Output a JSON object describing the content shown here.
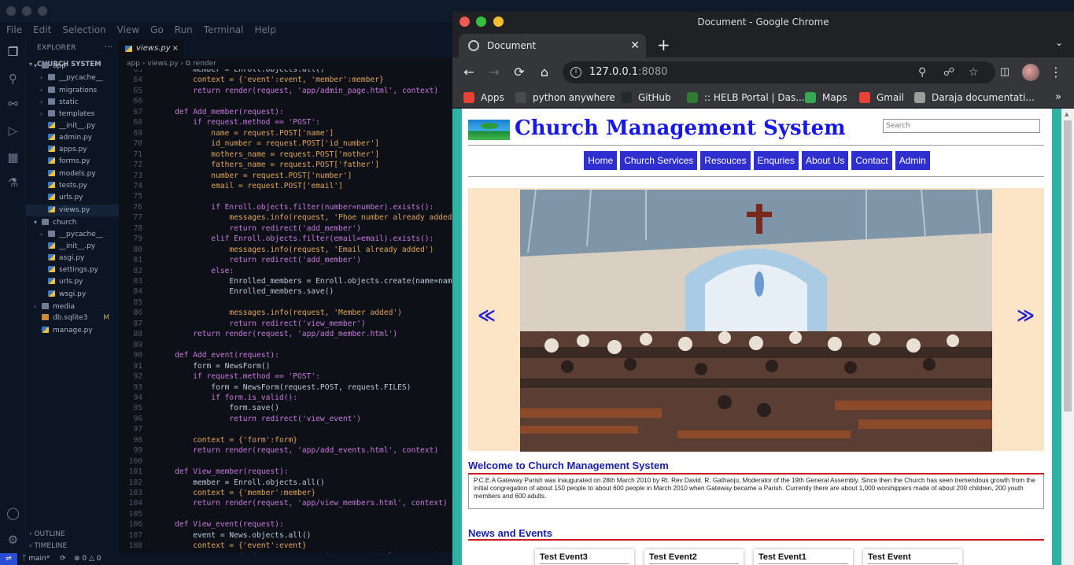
{
  "vscode": {
    "menu": [
      "File",
      "Edit",
      "Selection",
      "View",
      "Go",
      "Run",
      "Terminal",
      "Help"
    ],
    "explorer_label": "EXPLORER",
    "project_label": "CHURCH SYSTEM",
    "tree": [
      {
        "label": "app",
        "type": "folder",
        "open": true,
        "indent": 0
      },
      {
        "label": "__pycache__",
        "type": "folder",
        "indent": 1
      },
      {
        "label": "migrations",
        "type": "folder",
        "indent": 1
      },
      {
        "label": "static",
        "type": "folder",
        "indent": 1
      },
      {
        "label": "templates",
        "type": "folder",
        "indent": 1
      },
      {
        "label": "__init__.py",
        "type": "py",
        "indent": 1
      },
      {
        "label": "admin.py",
        "type": "py",
        "indent": 1
      },
      {
        "label": "apps.py",
        "type": "py",
        "indent": 1
      },
      {
        "label": "forms.py",
        "type": "py",
        "indent": 1
      },
      {
        "label": "models.py",
        "type": "py",
        "indent": 1
      },
      {
        "label": "tests.py",
        "type": "py",
        "indent": 1
      },
      {
        "label": "urls.py",
        "type": "py",
        "indent": 1
      },
      {
        "label": "views.py",
        "type": "py",
        "indent": 1
      },
      {
        "label": "church",
        "type": "folder",
        "open": true,
        "indent": 0
      },
      {
        "label": "__pycache__",
        "type": "folder",
        "indent": 1
      },
      {
        "label": "__init__.py",
        "type": "py",
        "indent": 1
      },
      {
        "label": "asgi.py",
        "type": "py",
        "indent": 1
      },
      {
        "label": "settings.py",
        "type": "py",
        "indent": 1
      },
      {
        "label": "urls.py",
        "type": "py",
        "indent": 1
      },
      {
        "label": "wsgi.py",
        "type": "py",
        "indent": 1
      },
      {
        "label": "media",
        "type": "folder",
        "indent": 0
      },
      {
        "label": "db.sqlite3",
        "type": "db",
        "indent": 0,
        "badge": "M"
      },
      {
        "label": "manage.py",
        "type": "py",
        "indent": 0
      }
    ],
    "outline_label": "OUTLINE",
    "timeline_label": "TIMELINE",
    "tab_label": "views.py",
    "breadcrumb": "app  ›  views.py  ›  ⧉ render",
    "code_lines": [
      {
        "n": "63",
        "t": "        member = Enroll.objects.all()"
      },
      {
        "n": "64",
        "t": "        context = {'event':event, 'member':member}"
      },
      {
        "n": "65",
        "t": "        return render(request, 'app/admin_page.html', context)"
      },
      {
        "n": "66",
        "t": ""
      },
      {
        "n": "67",
        "t": "    def Add_member(request):"
      },
      {
        "n": "68",
        "t": "        if request.method == 'POST':"
      },
      {
        "n": "69",
        "t": "            name = request.POST['name']"
      },
      {
        "n": "70",
        "t": "            id_number = request.POST['id_number']"
      },
      {
        "n": "71",
        "t": "            mothers_name = request.POST['mother']"
      },
      {
        "n": "72",
        "t": "            fathers_name = request.POST['father']"
      },
      {
        "n": "73",
        "t": "            number = request.POST['number']"
      },
      {
        "n": "74",
        "t": "            email = request.POST['email']"
      },
      {
        "n": "75",
        "t": ""
      },
      {
        "n": "76",
        "t": "            if Enroll.objects.filter(number=number).exists():"
      },
      {
        "n": "77",
        "t": "                messages.info(request, 'Phoe number already added')"
      },
      {
        "n": "78",
        "t": "                return redirect('add_member')"
      },
      {
        "n": "79",
        "t": "            elif Enroll.objects.filter(email=email).exists():"
      },
      {
        "n": "80",
        "t": "                messages.info(request, 'Email already added')"
      },
      {
        "n": "81",
        "t": "                return redirect('add_member')"
      },
      {
        "n": "82",
        "t": "            else:"
      },
      {
        "n": "83",
        "t": "                Enrolled_members = Enroll.objects.create(name=name,"
      },
      {
        "n": "84",
        "t": "                Enrolled_members.save()"
      },
      {
        "n": "85",
        "t": ""
      },
      {
        "n": "86",
        "t": "                messages.info(request, 'Member added')"
      },
      {
        "n": "87",
        "t": "                return redirect('view_member')"
      },
      {
        "n": "88",
        "t": "        return render(request, 'app/add_member.html')"
      },
      {
        "n": "89",
        "t": ""
      },
      {
        "n": "90",
        "t": "    def Add_event(request):"
      },
      {
        "n": "91",
        "t": "        form = NewsForm()"
      },
      {
        "n": "92",
        "t": "        if request.method == 'POST':"
      },
      {
        "n": "93",
        "t": "            form = NewsForm(request.POST, request.FILES)"
      },
      {
        "n": "94",
        "t": "            if form.is_valid():"
      },
      {
        "n": "95",
        "t": "                form.save()"
      },
      {
        "n": "96",
        "t": "                return redirect('view_event')"
      },
      {
        "n": "97",
        "t": ""
      },
      {
        "n": "98",
        "t": "        context = {'form':form}"
      },
      {
        "n": "99",
        "t": "        return render(request, 'app/add_events.html', context)"
      },
      {
        "n": "100",
        "t": ""
      },
      {
        "n": "101",
        "t": "    def View_member(request):"
      },
      {
        "n": "102",
        "t": "        member = Enroll.objects.all()"
      },
      {
        "n": "103",
        "t": "        context = {'member':member}"
      },
      {
        "n": "104",
        "t": "        return render(request, 'app/view_members.html', context)"
      },
      {
        "n": "105",
        "t": ""
      },
      {
        "n": "106",
        "t": "    def View_event(request):"
      },
      {
        "n": "107",
        "t": "        event = News.objects.all()"
      },
      {
        "n": "108",
        "t": "        context = {'event':event}"
      },
      {
        "n": "109",
        "t": "        return render(request, 'app/view_events.html', context)"
      }
    ],
    "status": {
      "branch": "main*",
      "errors": "0",
      "warnings": "0"
    }
  },
  "chrome": {
    "window_title": "Document - Google Chrome",
    "tab_title": "Document",
    "url_host": "127.0.0.1",
    "url_port": ":8080",
    "bookmarks": [
      {
        "label": "Apps",
        "icon_color": "#e94235"
      },
      {
        "label": "python anywhere",
        "icon_color": "#4a4a4a"
      },
      {
        "label": "GitHub",
        "icon_color": "#24292e"
      },
      {
        "label": ":: HELB Portal | Das...",
        "icon_color": "#2e7d32"
      },
      {
        "label": "Maps",
        "icon_color": "#34a853"
      },
      {
        "label": "Gmail",
        "icon_color": "#ea4335"
      },
      {
        "label": "Daraja documentati...",
        "icon_color": "#9e9e9e"
      }
    ]
  },
  "site": {
    "title": "Church Management System",
    "search_placeholder": "Search",
    "nav": [
      "Home",
      "Church Services",
      "Resouces",
      "Enquries",
      "About Us",
      "Contact",
      "Admin"
    ],
    "prev_arrow": "≪",
    "next_arrow": "≫",
    "welcome_heading": "Welcome to Church Management System",
    "welcome_text": "P.C.E.A Gateway Parish was inaugurated on 28th March 2010 by Rt. Rev David. R. Gathanju, Moderator of the 19th General Assembly. Since then the Church has seen tremendous growth from the initial congregation of about 150 people to about 600 people in March 2010 when Gateway became a Parish. Currently there are about 1,000 worshippers made of about 200 children, 200 youth members and 600 adults.",
    "events_heading": "News and Events",
    "events": [
      "Test Event3",
      "Test Event2",
      "Test Event1",
      "Test Event"
    ],
    "colors": {
      "nav_bg": "#2f2fcf",
      "title": "#1717e8",
      "frame": "#2bb3a4",
      "carousel_bg": "#fce4c7"
    }
  }
}
